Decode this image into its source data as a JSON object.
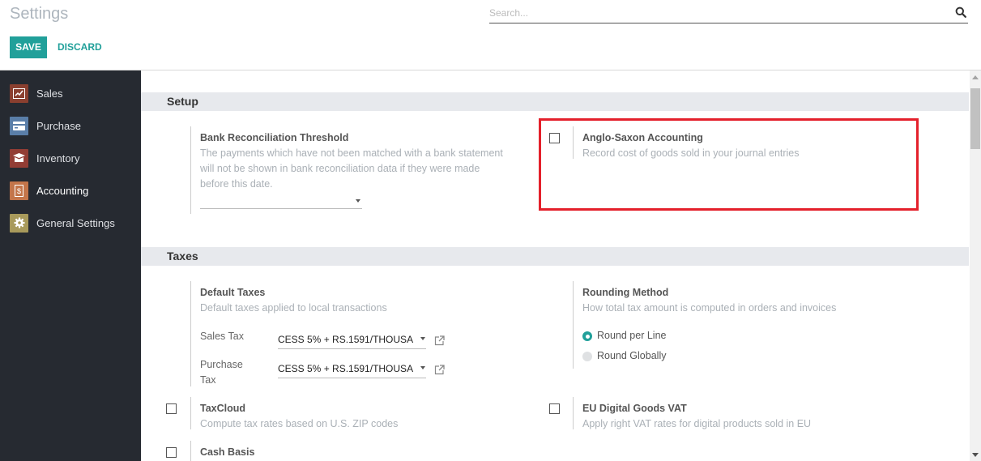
{
  "header": {
    "title": "Settings",
    "search_placeholder": "Search...",
    "search_icon": "search-icon",
    "save_label": "SAVE",
    "discard_label": "DISCARD"
  },
  "sidebar": {
    "items": [
      {
        "label": "Sales",
        "icon": "sales-chart-icon",
        "color": "#8a3f2f",
        "active": false
      },
      {
        "label": "Purchase",
        "icon": "purchase-card-icon",
        "color": "#5a7ea8",
        "active": false
      },
      {
        "label": "Inventory",
        "icon": "inventory-box-icon",
        "color": "#923d35",
        "active": false
      },
      {
        "label": "Accounting",
        "icon": "accounting-invoice-icon",
        "color": "#c3754a",
        "active": true
      },
      {
        "label": "General Settings",
        "icon": "gear-icon",
        "color": "#a89a5b",
        "active": false
      }
    ]
  },
  "sections": {
    "setup": {
      "title": "Setup",
      "bank_threshold": {
        "title": "Bank Reconciliation Threshold",
        "description_lines": [
          "The payments which have not been matched with a bank statement",
          "will not be shown in bank reconciliation data if they were made",
          "before this date."
        ],
        "value": ""
      },
      "anglo_saxon": {
        "title": "Anglo-Saxon Accounting",
        "description": "Record cost of goods sold in your journal entries",
        "checked": false
      }
    },
    "taxes": {
      "title": "Taxes",
      "default_taxes": {
        "title": "Default Taxes",
        "description": "Default taxes applied to local transactions",
        "sales_tax_label": "Sales Tax",
        "sales_tax_value": "CESS 5% + RS.1591/THOUSA",
        "purchase_tax_label_1": "Purchase",
        "purchase_tax_label_2": "Tax",
        "purchase_tax_value": "CESS 5% + RS.1591/THOUSA"
      },
      "rounding": {
        "title": "Rounding Method",
        "description": "How total tax amount is computed in orders and invoices",
        "options": [
          {
            "label": "Round per Line",
            "selected": true
          },
          {
            "label": "Round Globally",
            "selected": false
          }
        ]
      },
      "taxcloud": {
        "title": "TaxCloud",
        "description": "Compute tax rates based on U.S. ZIP codes",
        "checked": false
      },
      "eu_vat": {
        "title": "EU Digital Goods VAT",
        "description": "Apply right VAT rates for digital products sold in EU",
        "checked": false
      },
      "cash_basis": {
        "title": "Cash Basis",
        "checked": false
      }
    }
  },
  "colors": {
    "accent": "#21a09a",
    "sidebar_bg": "#262a31",
    "highlight": "#e4202b"
  }
}
